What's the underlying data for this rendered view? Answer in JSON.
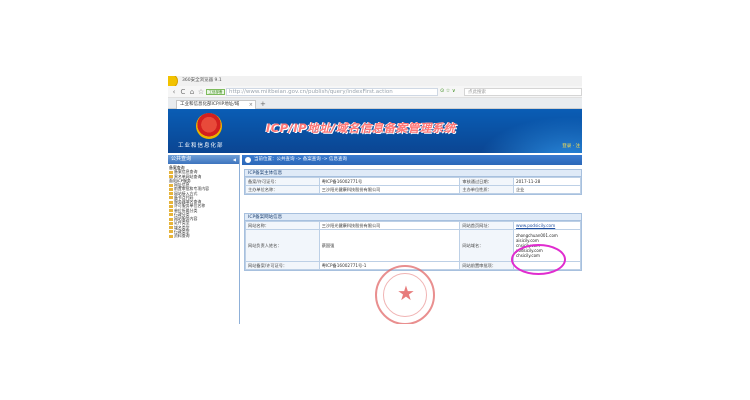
{
  "browser": {
    "window_title": "360安全浏览器 9.1",
    "address_badge": "工信部备案查询",
    "address_host": "http://www.miitbeian.gov.cn",
    "address_path": "/publish/query/indexFirst.action",
    "address_icons": "⊙ ☆ ∨",
    "search_placeholder": "点此搜索",
    "tab_title": "工业和信息化部ICP/IP地址/域",
    "tab_close": "×",
    "new_tab": "+",
    "nav": {
      "back": "‹",
      "refresh": "C",
      "home": "⌂",
      "star": "☆"
    }
  },
  "banner": {
    "ministry": "工业和信息化部",
    "system_title": "ICP/IP地址/域名信息备案管理系统",
    "login_link": "登录 · 注"
  },
  "sidebar": {
    "header": "公共查询",
    "arrow": "◀",
    "items": [
      {
        "label": "备案查询",
        "group": true
      },
      {
        "label": "备案信息查询",
        "group": false
      },
      {
        "label": "黑名单网站查询",
        "group": false
      },
      {
        "label": "面向ICP服务",
        "group": true
      },
      {
        "label": "网址信息",
        "group": false
      },
      {
        "label": "前置审批和专项内容",
        "group": false
      },
      {
        "label": "网站接入方式",
        "group": false
      },
      {
        "label": "备节点代码",
        "group": false
      },
      {
        "label": "服务器域名查询",
        "group": false
      },
      {
        "label": "许可服务单位名称",
        "group": false
      },
      {
        "label": "单位所属分类",
        "group": false
      },
      {
        "label": "行政分类",
        "group": false
      },
      {
        "label": "网站服务内容",
        "group": false
      },
      {
        "label": "证件类型",
        "group": false
      },
      {
        "label": "域名类型",
        "group": false
      },
      {
        "label": "行政类型",
        "group": false
      },
      {
        "label": "资料查询",
        "group": false
      }
    ]
  },
  "breadcrumb": "当前位置：公共查询 -> 备案查询 -> 信息查询",
  "panel1": {
    "header": "ICP备案主体信息",
    "rows": [
      [
        "备案/许可证号：",
        "粤ICP备16002771号",
        "审核通过日期：",
        "2017-11-28"
      ],
      [
        "主办单位名称：",
        "三沙阳光健康科技股份有限公司",
        "主办单位性质：",
        "企业"
      ]
    ]
  },
  "panel2": {
    "header": "ICP备案网站信息",
    "site_name_label": "网站名称：",
    "site_name": "三沙阳光健康科技股份有限公司",
    "homepage_label": "网站首页网址：",
    "homepage": "www.podsicily.com",
    "owner_label": "网站负责人姓名：",
    "owner": "蔡国强",
    "domain_label": "网站域名：",
    "domains": [
      "zhongchuan001.com",
      "aisicily.com",
      "cnsicily.com",
      "podsicily.com",
      "chsicily.com"
    ],
    "license_label": "网站备案/许可证号：",
    "license": "粤ICP备16002771号-1",
    "prereq_label": "网站前置审批项："
  }
}
